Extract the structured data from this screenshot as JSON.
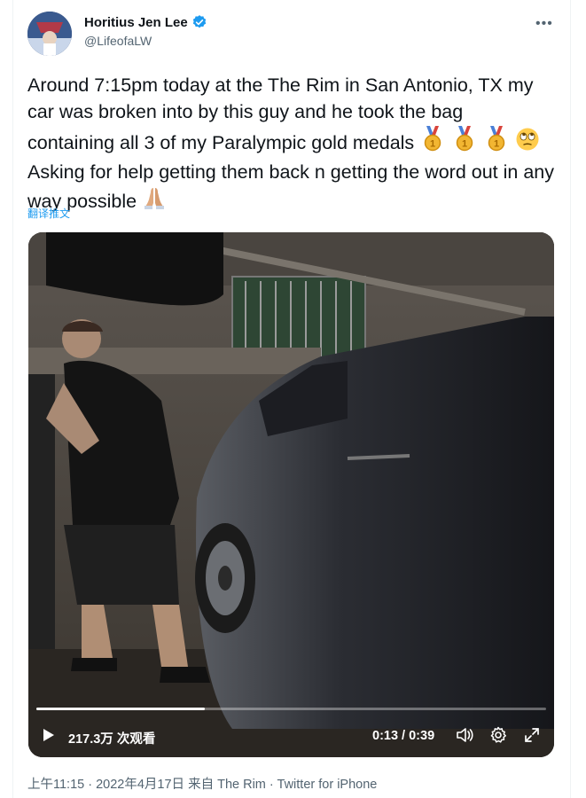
{
  "author": {
    "name": "Horitius Jen Lee",
    "handle": "@LifeofaLW",
    "verified": true
  },
  "tweet": {
    "text_before_emoji": "Around 7:15pm today at the The Rim in San Antonio, TX my car was broken into by this guy and he took the bag containing all 3 of my Paralympic gold medals",
    "text_middle": "Asking for help getting them back n getting the word out in any way possible",
    "emojis": [
      "gold-medal-icon",
      "gold-medal-icon",
      "gold-medal-icon",
      "face-with-rolling-eyes-icon",
      "folded-hands-icon"
    ],
    "translate_label": "翻译推文"
  },
  "video": {
    "views": "217.3万 次观看",
    "time": "0:13 / 0:39",
    "progress": 0.33,
    "controls": [
      "play-icon",
      "volume-icon",
      "settings-icon",
      "fullscreen-icon"
    ]
  },
  "meta": {
    "line": "上午11:15 · 2022年4月17日 来自 The Rim · Twitter for iPhone"
  },
  "colors": {
    "accent": "#1d9bf0",
    "secondary_text": "#536471",
    "medal_gold": "#f2b632",
    "medal_ribbon": "#4a7fd6"
  }
}
